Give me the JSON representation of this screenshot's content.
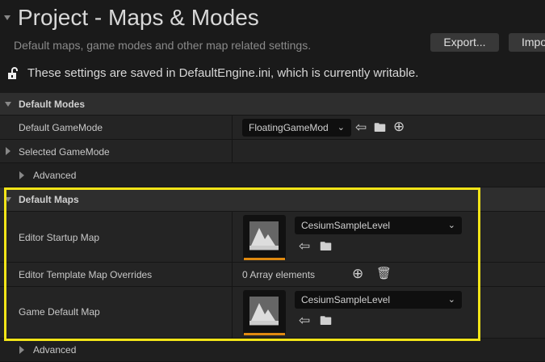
{
  "header": {
    "title": "Project - Maps & Modes",
    "subtitle": "Default maps, game modes and other map related settings.",
    "export_label": "Export...",
    "import_label": "Impo",
    "writable_notice": "These settings are saved in DefaultEngine.ini, which is currently writable."
  },
  "default_modes": {
    "title": "Default Modes",
    "default_gamemode_label": "Default GameMode",
    "default_gamemode_value": "FloatingGameMod",
    "selected_gamemode_label": "Selected GameMode",
    "advanced_label": "Advanced"
  },
  "default_maps": {
    "title": "Default Maps",
    "editor_startup_label": "Editor Startup Map",
    "editor_startup_value": "CesiumSampleLevel",
    "template_overrides_label": "Editor Template Map Overrides",
    "template_overrides_value": "0 Array elements",
    "game_default_label": "Game Default Map",
    "game_default_value": "CesiumSampleLevel",
    "advanced_label": "Advanced"
  },
  "colors": {
    "highlight": "#f2e418",
    "thumbnail_accent": "#e08a10"
  }
}
